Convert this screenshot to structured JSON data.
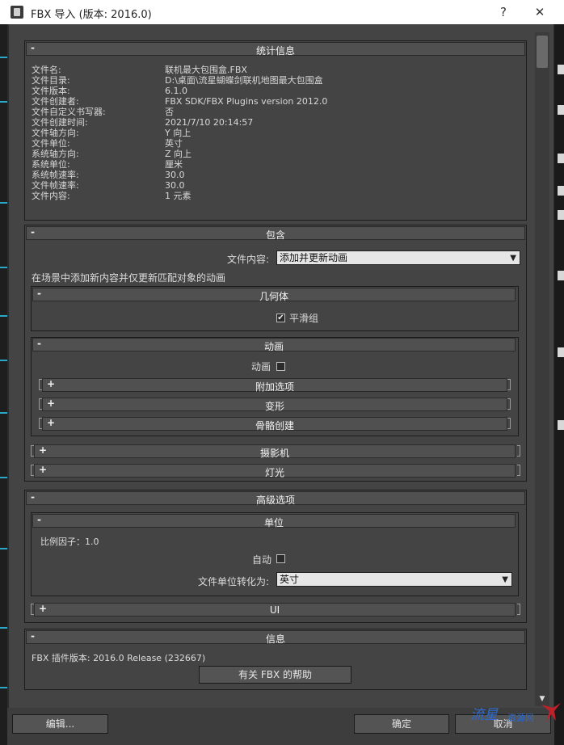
{
  "window": {
    "title": "FBX 导入 (版本: 2016.0)",
    "help": "?",
    "close": "✕"
  },
  "stats": {
    "header": "统计信息",
    "toggle": "-",
    "rows": [
      {
        "label": "文件名:",
        "value": "联机最大包围盒.FBX"
      },
      {
        "label": "文件目录:",
        "value": "D:\\桌面\\流星蝴蝶剑联机地图最大包围盒"
      },
      {
        "label": "文件版本:",
        "value": "6.1.0"
      },
      {
        "label": "文件创建者:",
        "value": "FBX SDK/FBX Plugins version 2012.0"
      },
      {
        "label": "文件自定义书写器:",
        "value": "否"
      },
      {
        "label": "文件创建时间:",
        "value": "2021/7/10  20:14:57"
      },
      {
        "label": "文件轴方向:",
        "value": "Y 向上"
      },
      {
        "label": "文件单位:",
        "value": "英寸"
      },
      {
        "label": "系统轴方向:",
        "value": "Z 向上"
      },
      {
        "label": "系统单位:",
        "value": "厘米"
      },
      {
        "label": "系统帧速率:",
        "value": "30.0"
      },
      {
        "label": "文件帧速率:",
        "value": "30.0"
      },
      {
        "label": "文件内容:",
        "value": "1 元素"
      }
    ]
  },
  "include": {
    "header": "包含",
    "toggle": "-",
    "content_label": "文件内容:",
    "content_value": "添加并更新动画",
    "description": "在场景中添加新内容并仅更新匹配对象的动画",
    "geometry": {
      "header": "几何体",
      "toggle": "-",
      "smoothing_label": "平滑组",
      "smoothing_mark": "✔"
    },
    "animation": {
      "header": "动画",
      "toggle": "-",
      "anim_label": "动画",
      "subs": [
        {
          "toggle": "+",
          "title": "附加选项"
        },
        {
          "toggle": "+",
          "title": "变形"
        },
        {
          "toggle": "+",
          "title": "骨骼创建"
        }
      ]
    },
    "camera": {
      "toggle": "+",
      "title": "摄影机"
    },
    "light": {
      "toggle": "+",
      "title": "灯光"
    }
  },
  "advanced": {
    "header": "高级选项",
    "toggle": "-",
    "units": {
      "header": "单位",
      "toggle": "-",
      "scale_label": "比例因子：1.0",
      "auto_label": "自动",
      "convert_label": "文件单位转化为:",
      "convert_value": "英寸"
    },
    "ui": {
      "toggle": "+",
      "title": "UI"
    }
  },
  "info": {
    "header": "信息",
    "toggle": "-",
    "version": "FBX 插件版本: 2016.0 Release (232667)",
    "help_button": "有关 FBX 的帮助"
  },
  "footer": {
    "edit": "编辑...",
    "ok": "确定",
    "cancel": "取消"
  },
  "watermark": {
    "text": "流星",
    "sub": "资源网"
  },
  "colors": {
    "accent": "#2aa7c9",
    "panel": "#444444",
    "bar": "#505050"
  }
}
